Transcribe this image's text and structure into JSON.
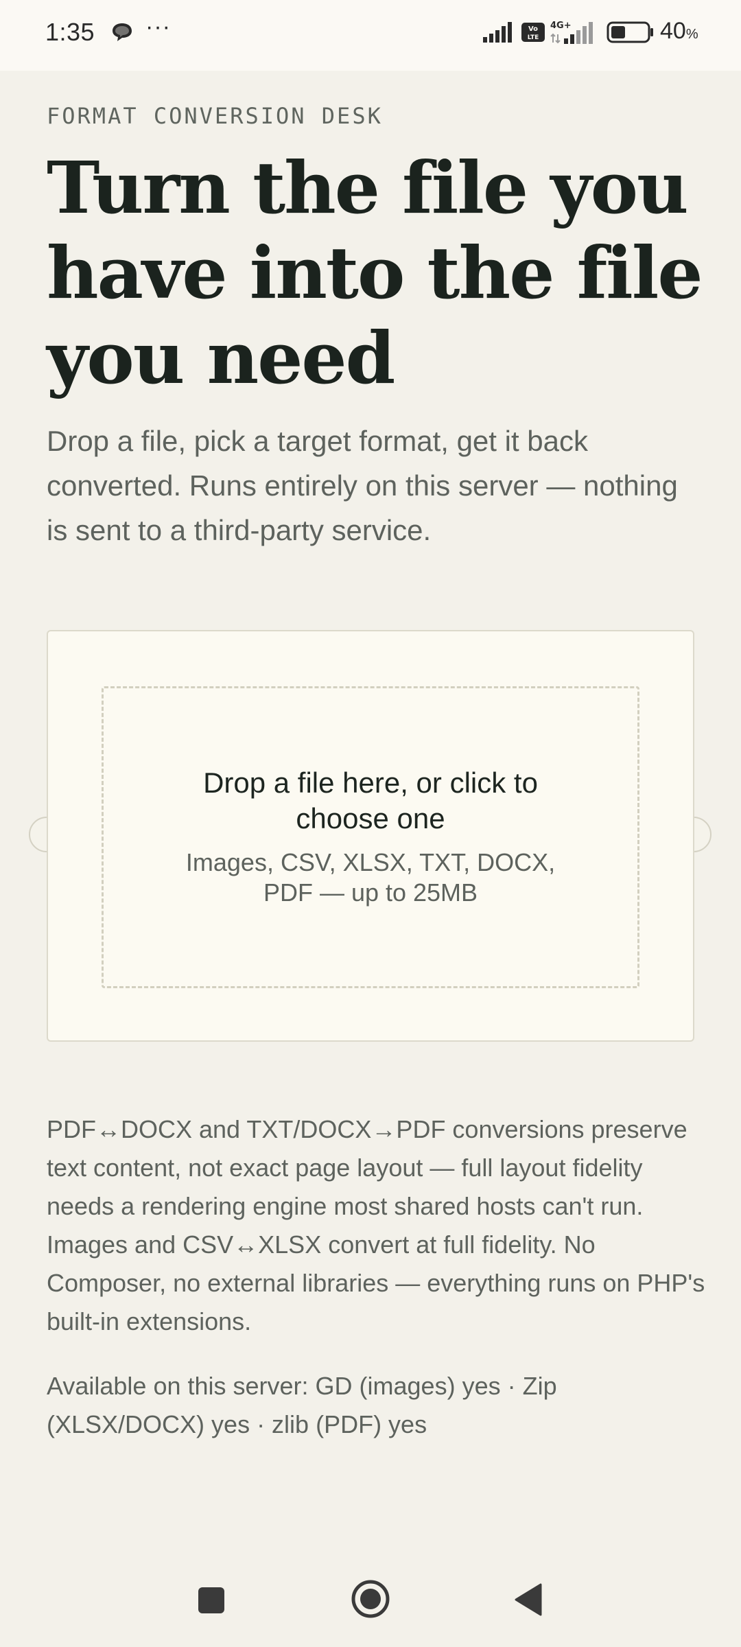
{
  "status_bar": {
    "time": "1:35",
    "more": "···",
    "battery_percent": "40",
    "battery_unit": "%",
    "battery_level": 0.4,
    "icons": [
      "chat-bubble-icon",
      "signal-icon",
      "volte-icon",
      "4g-signal-icon",
      "battery-icon"
    ]
  },
  "page": {
    "eyebrow": "FORMAT CONVERSION DESK",
    "headline": "Turn the file you have into the file you need",
    "intro": "Drop a file, pick a target format, get it back converted. Runs entirely on this server — nothing is sent to a third-party service.",
    "dropzone": {
      "title": "Drop a file here, or click to choose one",
      "subtitle": "Images, CSV, XLSX, TXT, DOCX, PDF — up to 25MB"
    },
    "note": "PDF↔DOCX and TXT/DOCX→PDF conversions preserve text content, not exact page layout — full layout fidelity needs a rendering engine most shared hosts can't run. Images and CSV↔XLSX convert at full fidelity. No Composer, no external libraries — everything runs on PHP's built-in extensions.",
    "availability": "Available on this server: GD (images) yes · Zip (XLSX/DOCX) yes · zlib (PDF) yes"
  },
  "nav": {
    "buttons": [
      "recents",
      "home",
      "back"
    ]
  },
  "colors": {
    "background": "#f3f1ea",
    "card": "#fcfaf2",
    "heading": "#1b231e",
    "body_text": "#5d625d"
  }
}
